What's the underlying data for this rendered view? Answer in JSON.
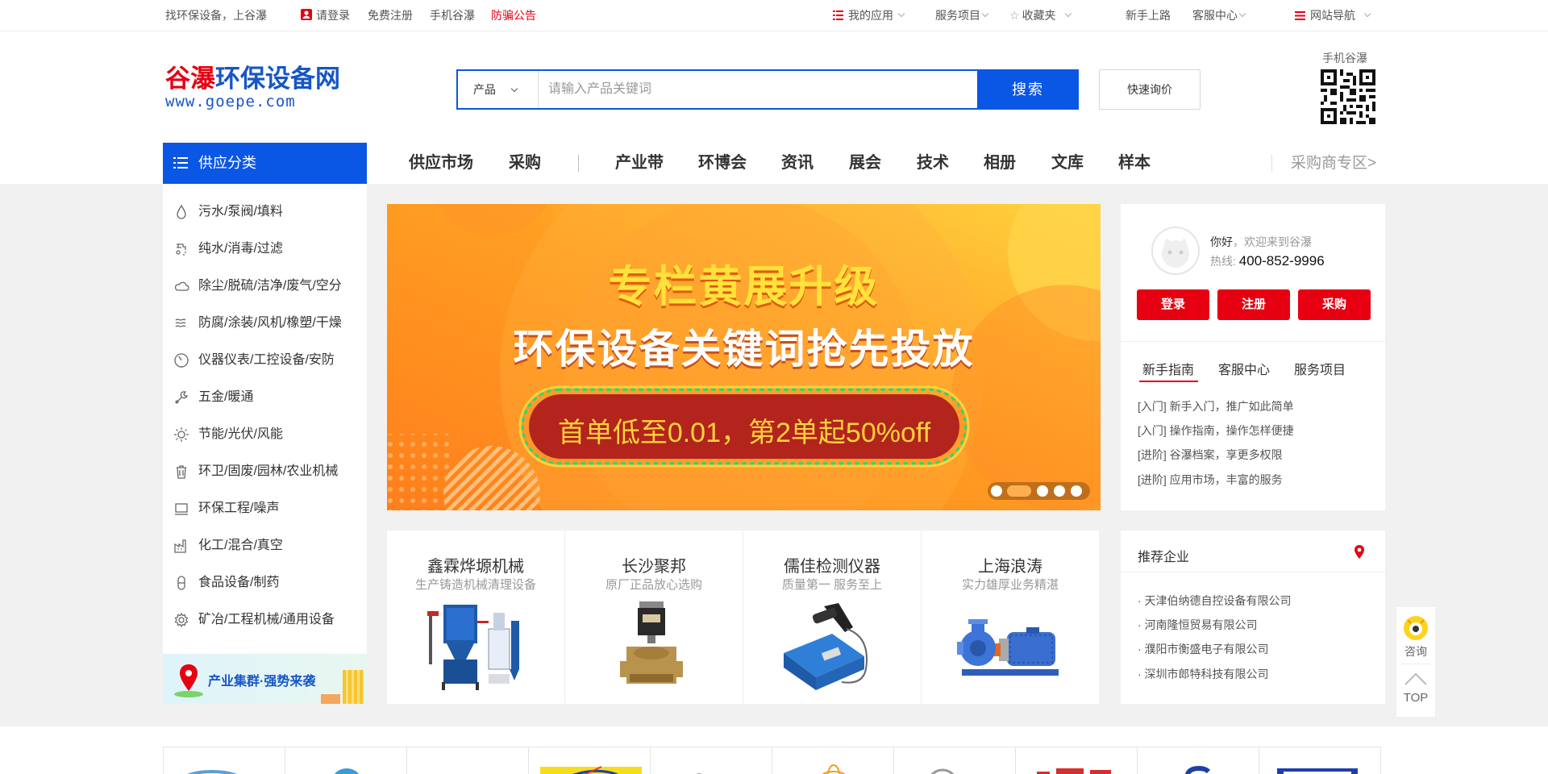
{
  "topbar": {
    "slogan": "找环保设备，上谷瀑",
    "login": "请登录",
    "register": "免费注册",
    "mobile": "手机谷瀑",
    "notice": "防骗公告",
    "my_apps": "我的应用",
    "services": "服务项目",
    "favorites": "收藏夹",
    "newbie": "新手上路",
    "support": "客服中心",
    "site_nav": "网站导航"
  },
  "header": {
    "logo_red": "谷瀑",
    "logo_blue": "环保设备网",
    "logo_url": "www.goepe.com",
    "search_type": "产品",
    "search_placeholder": "请输入产品关键词",
    "search_button": "搜索",
    "quick_quote": "快速询价",
    "qr_label": "手机谷瀑"
  },
  "nav": {
    "categories_label": "供应分类",
    "items": [
      "供应市场",
      "采购",
      "产业带",
      "环博会",
      "资讯",
      "展会",
      "技术",
      "相册",
      "文库",
      "样本"
    ],
    "buyer_zone": "采购商专区>"
  },
  "sidebar": {
    "categories": [
      {
        "label": "污水/泵阀/填料",
        "icon": "water-drop-icon"
      },
      {
        "label": "纯水/消毒/过滤",
        "icon": "faucet-icon"
      },
      {
        "label": "除尘/脱硫/洁净/废气/空分",
        "icon": "cloud-icon"
      },
      {
        "label": "防腐/涂装/风机/橡塑/干燥",
        "icon": "wind-icon"
      },
      {
        "label": "仪器仪表/工控设备/安防",
        "icon": "gauge-icon"
      },
      {
        "label": "五金/暖通",
        "icon": "wrench-icon"
      },
      {
        "label": "节能/光伏/风能",
        "icon": "sun-icon"
      },
      {
        "label": "环卫/固废/园林/农业机械",
        "icon": "trash-bin-icon"
      },
      {
        "label": "环保工程/噪声",
        "icon": "monitor-icon"
      },
      {
        "label": "化工/混合/真空",
        "icon": "factory-icon"
      },
      {
        "label": "食品设备/制药",
        "icon": "capsule-icon"
      },
      {
        "label": "矿冶/工程机械/通用设备",
        "icon": "gear-icon"
      }
    ],
    "promo_text": "产业集群·强势来袭"
  },
  "banner": {
    "line1": "专栏黄展升级",
    "line2": "环保设备关键词抢先投放",
    "line3": "首单低至0.01，第2单起50%off",
    "colors": {
      "bg_start": "#ff8a1f",
      "bg_end": "#ffd23c",
      "headline": "#ffe23a",
      "pill": "#b3241d"
    }
  },
  "user_box": {
    "greeting": "你好",
    "welcome": "，欢迎来到谷瀑",
    "hotline_label": "热线:",
    "hotline": "400-852-9996",
    "btn_login": "登录",
    "btn_register": "注册",
    "btn_purchase": "采购",
    "tabs": [
      "新手指南",
      "客服中心",
      "服务项目"
    ],
    "guides": [
      "[入门] 新手入门，推广如此简单",
      "[入门] 操作指南，操作怎样便捷",
      "[进阶] 谷瀑档案，享更多权限",
      "[进阶] 应用市场，丰富的服务"
    ]
  },
  "products": [
    {
      "name": "鑫霖烨塬机械",
      "slogan": "生产铸造机械清理设备",
      "icon": "blasting-machine-icon"
    },
    {
      "name": "长沙聚邦",
      "slogan": "原厂正品放心选购",
      "icon": "solenoid-valve-icon"
    },
    {
      "name": "儒佳检测仪器",
      "slogan": "质量第一 服务至上",
      "icon": "magnetic-detector-icon"
    },
    {
      "name": "上海浪涛",
      "slogan": "实力雄厚业务精湛",
      "icon": "water-pump-icon"
    }
  ],
  "recommended": {
    "title": "推荐企业",
    "companies": [
      "· 天津伯纳德自控设备有限公司",
      "· 河南隆恒贸易有限公司",
      "· 濮阳市衡盛电子有限公司",
      "· 深圳市郎特科技有限公司"
    ]
  },
  "float_bar": {
    "consult": "咨询",
    "top": "TOP"
  },
  "colors": {
    "primary_blue": "#0a57e6",
    "brand_red": "#e60012",
    "page_grey": "#f1f1f1"
  }
}
